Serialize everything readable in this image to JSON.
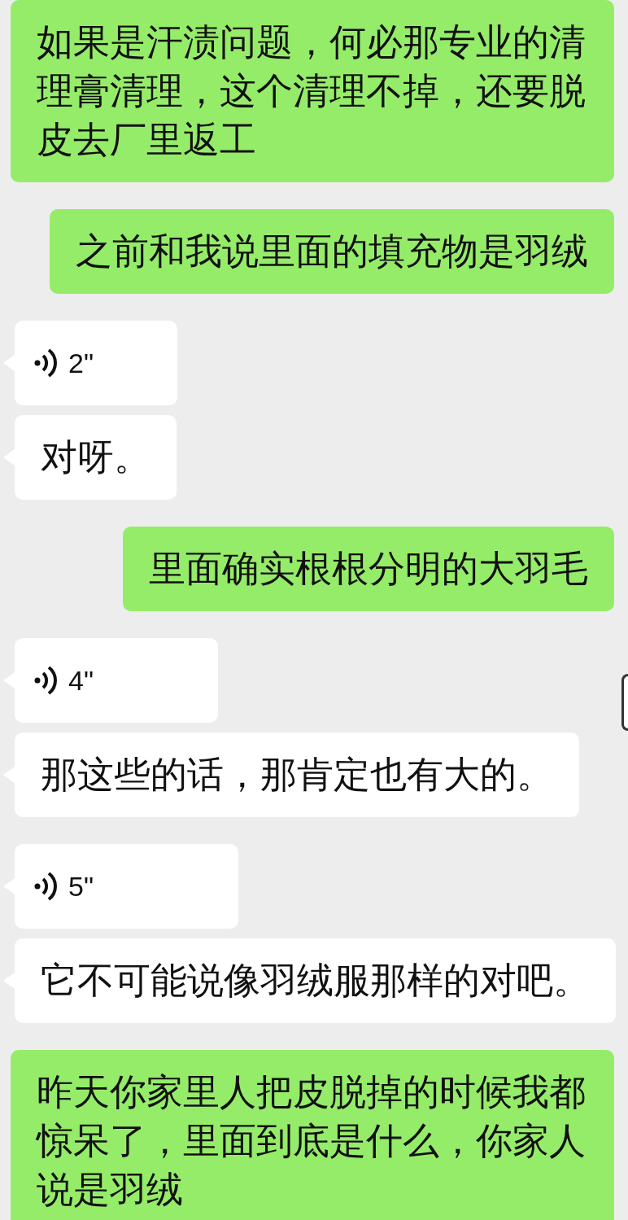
{
  "messages": [
    {
      "outgoing": true,
      "kind": "text",
      "text": "如果是汗渍问题，何必那专业的清理膏清理，这个清理不掉，还要脱皮去厂里返工"
    },
    {
      "outgoing": true,
      "kind": "text",
      "text": "之前和我说里面的填充物是羽绒"
    },
    {
      "outgoing": false,
      "kind": "voice",
      "duration": "2\""
    },
    {
      "outgoing": false,
      "kind": "text",
      "text": "对呀。"
    },
    {
      "outgoing": true,
      "kind": "text",
      "text": "里面确实根根分明的大羽毛"
    },
    {
      "outgoing": false,
      "kind": "voice",
      "duration": "4\""
    },
    {
      "outgoing": false,
      "kind": "text",
      "text": "那这些的话，那肯定也有大的。"
    },
    {
      "outgoing": false,
      "kind": "voice",
      "duration": "5\""
    },
    {
      "outgoing": false,
      "kind": "text",
      "text": "它不可能说像羽绒服那样的对吧。"
    },
    {
      "outgoing": true,
      "kind": "text",
      "text": "昨天你家里人把皮脱掉的时候我都惊呆了，里面到底是什么，你家人说是羽绒"
    }
  ]
}
